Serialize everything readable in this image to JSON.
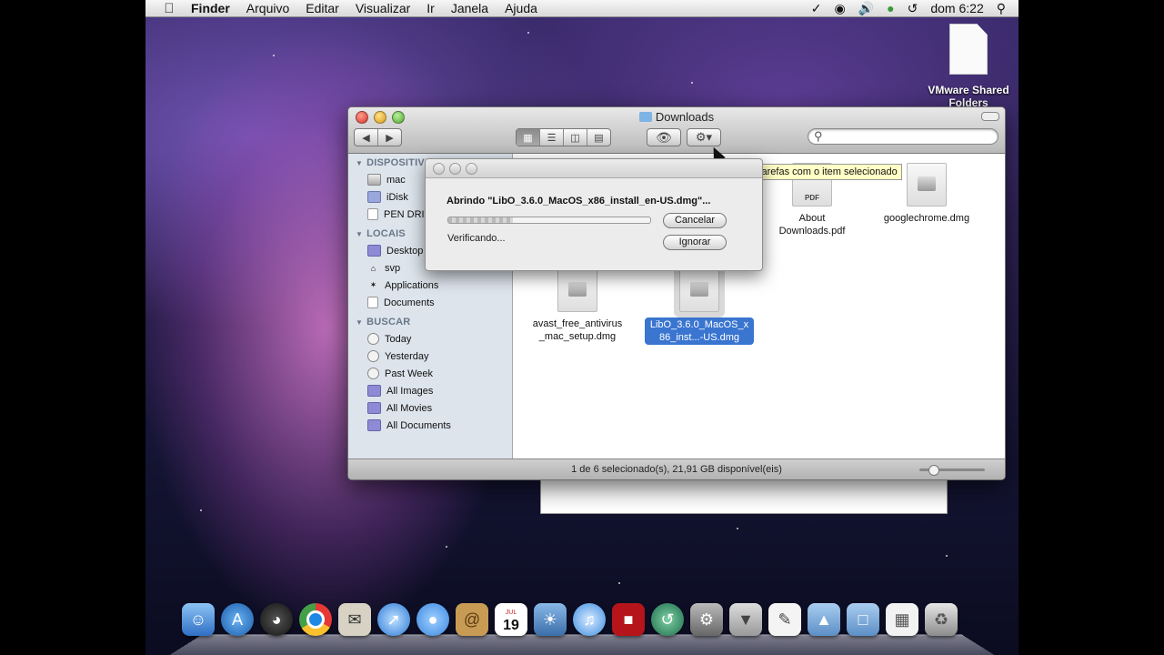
{
  "menubar": {
    "apple_icon": "apple-icon",
    "app": "Finder",
    "items": [
      "Arquivo",
      "Editar",
      "Visualizar",
      "Ir",
      "Janela",
      "Ajuda"
    ],
    "clock": "dom 6:22"
  },
  "desktop": {
    "vmware_label": "VMware Shared Folders"
  },
  "finder": {
    "title": "Downloads",
    "status": "1 de 6 selecionado(s), 21,91 GB disponível(eis)",
    "sidebar": {
      "devices_header": "DISPOSITIVOS",
      "devices": [
        "mac",
        "iDisk",
        "PEN DRIVE"
      ],
      "places_header": "LOCAIS",
      "places": [
        "Desktop",
        "svp",
        "Applications",
        "Documents"
      ],
      "search_header": "BUSCAR",
      "searches": [
        "Today",
        "Yesterday",
        "Past Week",
        "All Images",
        "All Movies",
        "All Documents"
      ]
    },
    "files": [
      {
        "name": "About Downloads.pdf"
      },
      {
        "name": "googlechrome.dmg"
      },
      {
        "name": "avast_free_antivirus_mac_setup.dmg"
      },
      {
        "name": "LibO_3.6.0_MacOS_x86_inst...-US.dmg"
      }
    ]
  },
  "tooltip": "Executar tarefas com o item selecionado",
  "dialog": {
    "message": "Abrindo \"LibO_3.6.0_MacOS_x86_install_en-US.dmg\"...",
    "status": "Verificando...",
    "cancel": "Cancelar",
    "ignore": "Ignorar"
  },
  "dock": {
    "calendar_day": "19",
    "calendar_month": "JUL",
    "items": [
      "finder-icon",
      "app-store-icon",
      "dashboard-icon",
      "chrome-icon",
      "mail-stamp-icon",
      "safari-icon",
      "ichat-icon",
      "address-book-icon",
      "ical-icon",
      "iphoto-icon",
      "itunes-icon",
      "photo-booth-icon",
      "time-machine-icon",
      "system-preferences-icon",
      "installer-icon",
      "preview-icon",
      "applications-folder-icon",
      "documents-folder-icon",
      "downloads-stack-icon",
      "trash-icon"
    ]
  }
}
